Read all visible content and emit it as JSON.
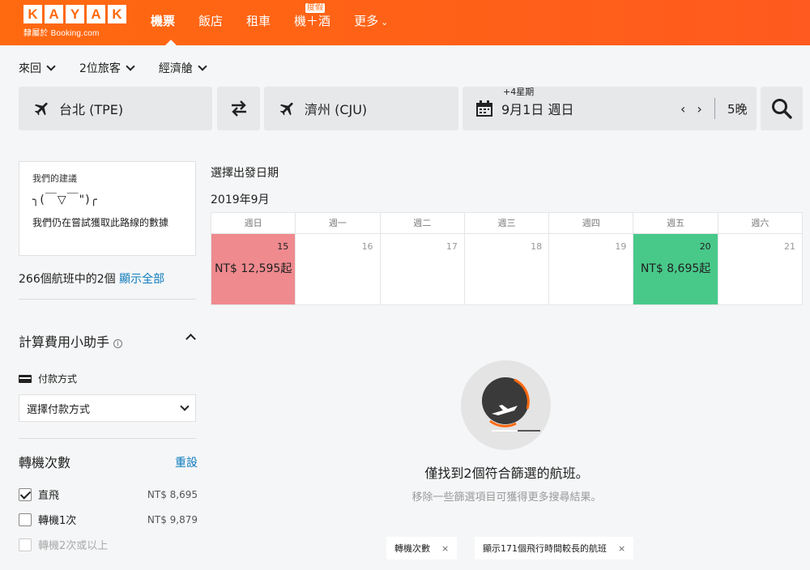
{
  "brand": {
    "letters": [
      "K",
      "A",
      "Y",
      "A",
      "K"
    ],
    "subtitle": "隸屬於 Booking.com"
  },
  "nav": {
    "items": [
      {
        "label": "機票",
        "active": true
      },
      {
        "label": "飯店"
      },
      {
        "label": "租車"
      },
      {
        "label": "機＋酒",
        "badge": "度假"
      },
      {
        "label": "更多"
      }
    ]
  },
  "search": {
    "trip_type": "來回",
    "travelers": "2位旅客",
    "cabin": "經濟艙",
    "origin": "台北 (TPE)",
    "destination": "濟州 (CJU)",
    "date_hint": "+4星期",
    "date": "9月1日 週日",
    "nights": "5晚"
  },
  "recommendation": {
    "title": "我們的建議",
    "face": "╮(￣▽￣\")╭",
    "message": "我們仍在嘗試獲取此路線的數據"
  },
  "result_count": {
    "text": "266個航班中的2個",
    "show_all": "顯示全部"
  },
  "fee_assistant": {
    "title": "計算費用小助手",
    "info_icon": "i",
    "payment_label": "付款方式",
    "payment_placeholder": "選擇付款方式"
  },
  "stops": {
    "title": "轉機次數",
    "reset": "重設",
    "options": [
      {
        "label": "直飛",
        "price": "NT$ 8,695",
        "checked": true
      },
      {
        "label": "轉機1次",
        "price": "NT$ 9,879",
        "checked": false
      },
      {
        "label": "轉機2次或以上",
        "price": "",
        "checked": false,
        "disabled": true
      }
    ]
  },
  "calendar": {
    "title": "選擇出發日期",
    "month": "2019年9月",
    "weekdays": [
      "週日",
      "週一",
      "週二",
      "週三",
      "週四",
      "週五",
      "週六"
    ],
    "days": [
      {
        "day": "15",
        "price": "NT$ 12,595起",
        "tone": "red"
      },
      {
        "day": "16",
        "price": ""
      },
      {
        "day": "17",
        "price": ""
      },
      {
        "day": "18",
        "price": ""
      },
      {
        "day": "19",
        "price": ""
      },
      {
        "day": "20",
        "price": "NT$ 8,695起",
        "tone": "green"
      },
      {
        "day": "21",
        "price": ""
      }
    ],
    "colors": {
      "red": "#ef8a8f",
      "green": "#48c98a"
    }
  },
  "empty_state": {
    "message": "僅找到2個符合篩選的航班。",
    "hint": "移除一些篩選項目可獲得更多搜尋結果。"
  },
  "filter_chips": [
    {
      "label": "轉機次數",
      "close": "×"
    },
    {
      "label": "顯示171個飛行時間較長的航班",
      "close": "×"
    }
  ],
  "theme": {
    "brand_orange": "#ff690f",
    "link_blue": "#0d7bbd"
  }
}
